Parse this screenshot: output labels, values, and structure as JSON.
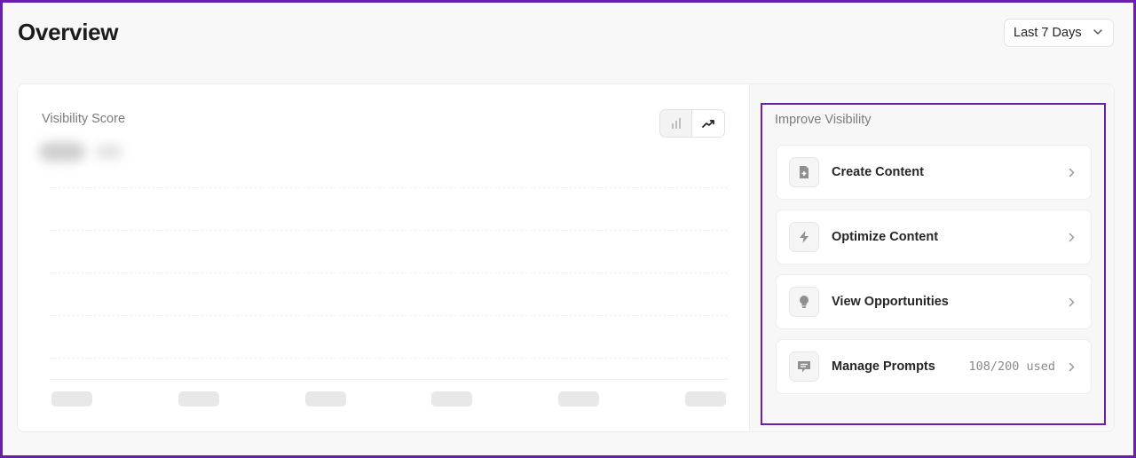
{
  "header": {
    "title": "Overview",
    "date_range": {
      "selected": "Last 7 Days",
      "icon": "chevron-down-icon"
    }
  },
  "visibility": {
    "label": "Visibility Score",
    "chart_toggle": [
      {
        "name": "bar-chart",
        "icon": "bar-chart-icon",
        "active": false
      },
      {
        "name": "trend-chart",
        "icon": "trend-up-icon",
        "active": true
      }
    ]
  },
  "improve": {
    "label": "Improve Visibility",
    "actions": [
      {
        "label": "Create Content",
        "icon": "file-plus-icon",
        "usage": ""
      },
      {
        "label": "Optimize Content",
        "icon": "lightning-icon",
        "usage": ""
      },
      {
        "label": "View Opportunities",
        "icon": "lightbulb-icon",
        "usage": ""
      },
      {
        "label": "Manage Prompts",
        "icon": "message-icon",
        "usage": "108/200 used"
      }
    ]
  },
  "colors": {
    "highlight": "#6a1fa8",
    "icon_gray": "#8f8f8f"
  }
}
